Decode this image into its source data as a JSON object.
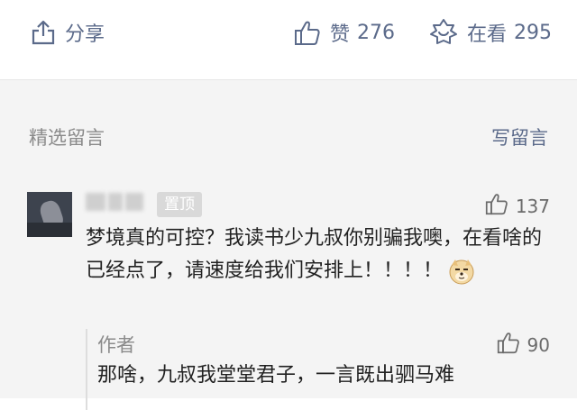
{
  "action_bar": {
    "share_label": "分享",
    "like_label": "赞",
    "like_count": "276",
    "watch_label": "在看",
    "watch_count": "295"
  },
  "comments": {
    "section_title": "精选留言",
    "write_label": "写留言",
    "items": [
      {
        "pin_badge": "置顶",
        "likes": "137",
        "text": "梦境真的可控？我读书少九叔你别骗我噢，在看啥的已经点了，请速度给我们安排上！！！！",
        "emoji": "doge-emoji",
        "reply": {
          "author_label": "作者",
          "likes": "90",
          "text": "那啥，九叔我堂堂君子，一言既出驷马难"
        }
      }
    ]
  },
  "colors": {
    "link": "#5b6a8a",
    "muted": "#8a8a8a",
    "background_gray": "#f4f4f4"
  }
}
